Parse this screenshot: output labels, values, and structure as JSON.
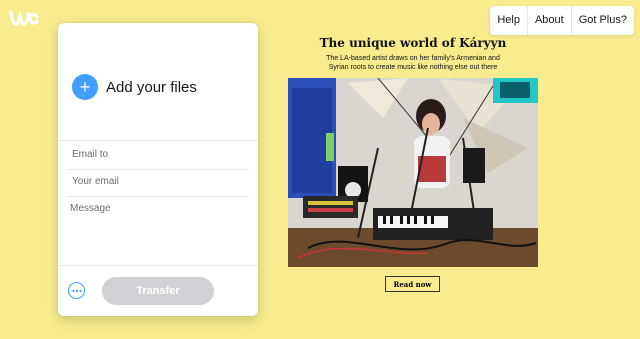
{
  "nav": {
    "items": [
      "Help",
      "About",
      "Got Plus?"
    ]
  },
  "panel": {
    "add_files_label": "Add your files",
    "add_icon": "+",
    "email_to_placeholder": "Email to",
    "your_email_placeholder": "Your email",
    "message_placeholder": "Message",
    "transfer_label": "Transfer"
  },
  "ad": {
    "title": "The unique world of Káryyn",
    "subtitle_line1": "The LA-based artist draws on her family's Armenian and",
    "subtitle_line2": "Syrian roots to create music like nothing else out there",
    "button_label": "Read now"
  },
  "colors": {
    "background": "#f8ec8e",
    "accent": "#409fff",
    "transfer_disabled": "#cfd1d4"
  },
  "icons": {
    "logo": "wetransfer-logo",
    "add": "plus-icon",
    "more": "more-options-icon"
  }
}
